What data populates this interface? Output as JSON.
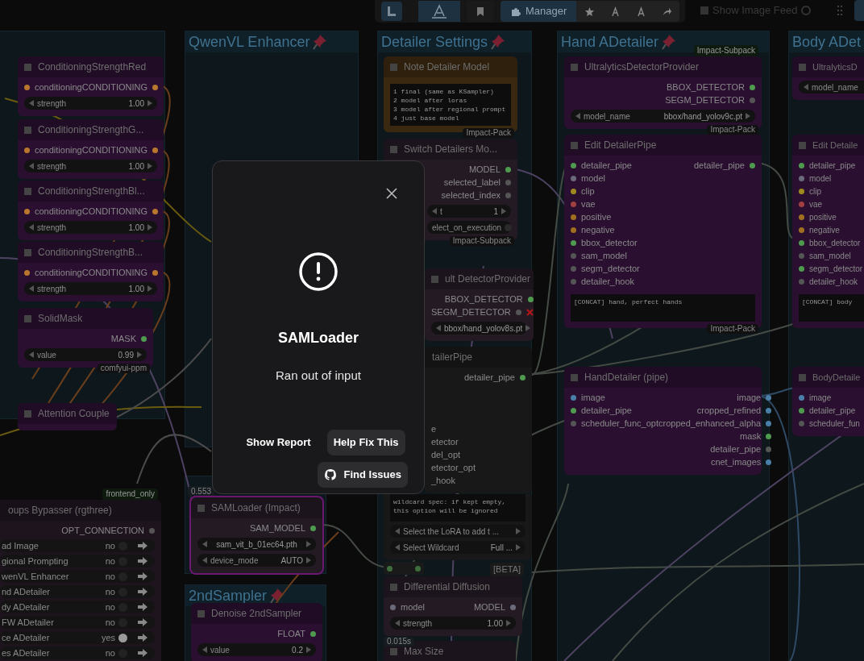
{
  "toolbar": {
    "manager": "Manager",
    "image_feed": "Show Image Feed"
  },
  "groups": [
    {
      "title": "QwenVL Enhancer",
      "pinned": true
    },
    {
      "title": "Detailer Settings",
      "pinned": true
    },
    {
      "title": "Hand ADetailer",
      "pinned": true
    },
    {
      "title": "Body ADet",
      "pinned": false
    },
    {
      "title": "2ndSampler",
      "pinned": true
    }
  ],
  "nodes": [
    {
      "title": "ConditioningStrengthRed",
      "color": "#2a0f30",
      "inputs": [
        {
          "label": "conditioning",
          "color": "#b8772c"
        }
      ],
      "outputs": [
        {
          "label": "CONDITIONING",
          "color": "#b8772c"
        }
      ],
      "widgets": [
        {
          "label": "strength",
          "value": "1.00"
        }
      ]
    },
    {
      "title": "ConditioningStrengthG...",
      "color": "#2a0f30",
      "inputs": [
        {
          "label": "conditioning",
          "color": "#b8772c"
        }
      ],
      "outputs": [
        {
          "label": "CONDITIONING",
          "color": "#b8772c"
        }
      ],
      "widgets": [
        {
          "label": "strength",
          "value": "1.00"
        }
      ]
    },
    {
      "title": "ConditioningStrengthBl...",
      "color": "#2a0f30",
      "inputs": [
        {
          "label": "conditioning",
          "color": "#b8772c"
        }
      ],
      "outputs": [
        {
          "label": "CONDITIONING",
          "color": "#b8772c"
        }
      ],
      "widgets": [
        {
          "label": "strength",
          "value": "1.00"
        }
      ]
    },
    {
      "title": "ConditioningStrengthB...",
      "color": "#2a0f30",
      "inputs": [
        {
          "label": "conditioning",
          "color": "#b8772c"
        }
      ],
      "outputs": [
        {
          "label": "CONDITIONING",
          "color": "#b8772c"
        }
      ],
      "widgets": [
        {
          "label": "strength",
          "value": "1.00"
        }
      ]
    },
    {
      "title": "SolidMask",
      "color": "#2a0f30",
      "outputs": [
        {
          "label": "MASK",
          "color": "#4e9a4e"
        }
      ],
      "widgets": [
        {
          "label": "value",
          "value": "0.99"
        }
      ],
      "badge": "comfyui-ppm"
    },
    {
      "title": "Attention Couple",
      "color": "#2a0f30"
    },
    {
      "title": "Note Detailer Model",
      "color": "#3a2810",
      "text": "1 final (same as KSampler)\n2 model after loras\n3 model after regional prompt\n4 just base model",
      "badge": "Impact-Pack"
    },
    {
      "title": "Switch Detailers Mo...",
      "color": "#241a24",
      "outputs": [
        {
          "label": "MODEL",
          "color": "#4e9a4e"
        },
        {
          "label": "selected_label",
          "color": "#555555"
        },
        {
          "label": "selected_index",
          "color": "#555555"
        }
      ],
      "widgets": [
        {
          "label": "t",
          "value": "1"
        },
        {
          "label": "elect_on_execution",
          "kind": "toggle"
        }
      ],
      "badge": "Impact-Subpack"
    },
    {
      "title": "ult DetectorProvider",
      "color": "#241a24",
      "outputs": [
        {
          "label": "BBOX_DETECTOR",
          "color": "#4e9a4e"
        },
        {
          "label": "SEGM_DETECTOR",
          "color": "#555555",
          "error": true
        }
      ],
      "widgets": [
        {
          "value": "bbox/hand_yolov8s.pt"
        }
      ]
    },
    {
      "title": "tailerPipe",
      "color": "#181818",
      "outputs": [
        {
          "label": "detailer_pipe",
          "color": "#4e9a4e"
        }
      ],
      "inputs": [
        {
          "label": "e"
        },
        {
          "label": "etector"
        },
        {
          "label": "del_opt"
        },
        {
          "label": "etector_opt"
        },
        {
          "label": "_hook"
        }
      ],
      "text": "wildcard spec: if kept empty, this option will be ignored",
      "widgets": [
        {
          "label": "Select the LoRA to add t ..."
        },
        {
          "label": "Select Wildcard",
          "value": "Full ..."
        }
      ]
    },
    {
      "kind": "reroute",
      "badge": "[BETA]"
    },
    {
      "title": "Differential Diffusion",
      "color": "#241a24",
      "inputs": [
        {
          "label": "model",
          "color": "#6a6a7a"
        }
      ],
      "outputs": [
        {
          "label": "MODEL",
          "color": "#6a6a7a"
        }
      ],
      "widgets": [
        {
          "label": "strength",
          "value": "1.00"
        }
      ],
      "timing": "0.015s"
    },
    {
      "title": "Max Size",
      "color": "#241a24"
    },
    {
      "title": "UltralyticsDetectorProvider",
      "color": "#2a0f30",
      "badge_above": "Impact-Subpack",
      "outputs": [
        {
          "label": "BBOX_DETECTOR",
          "color": "#4e9a4e"
        },
        {
          "label": "SEGM_DETECTOR",
          "color": "#555555"
        }
      ],
      "widgets": [
        {
          "label": "model_name",
          "value": "bbox/hand_yolov9c.pt"
        }
      ],
      "badge": "Impact-Pack"
    },
    {
      "title": "Edit DetailerPipe",
      "color": "#2a0f30",
      "inputs": [
        {
          "label": "detailer_pipe",
          "color": "#4e9a4e"
        },
        {
          "label": "model",
          "color": "#6a6a7a"
        },
        {
          "label": "clip",
          "color": "#a08a20"
        },
        {
          "label": "vae",
          "color": "#a04040"
        },
        {
          "label": "positive",
          "color": "#a07020"
        },
        {
          "label": "negative",
          "color": "#a07020"
        },
        {
          "label": "bbox_detector",
          "color": "#4e9a4e"
        },
        {
          "label": "sam_model",
          "color": "#555555"
        },
        {
          "label": "segm_detector",
          "color": "#555555"
        },
        {
          "label": "detailer_hook",
          "color": "#555555"
        }
      ],
      "outputs": [
        {
          "label": "detailer_pipe",
          "color": "#4e9a4e"
        }
      ],
      "text": "[CONCAT] hand, perfect hands",
      "badge": "Impact-Pack"
    },
    {
      "title": "HandDetailer (pipe)",
      "color": "#2a0f30",
      "inputs": [
        {
          "label": "image",
          "color": "#4a7fa8"
        },
        {
          "label": "detailer_pipe",
          "color": "#4e9a4e"
        },
        {
          "label": "scheduler_func_opt",
          "color": "#555555"
        }
      ],
      "outputs": [
        {
          "label": "image",
          "color": "#4a7fa8"
        },
        {
          "label": "cropped_refined",
          "color": "#4a7fa8"
        },
        {
          "label": "cropped_enhanced_alpha",
          "color": "#4a7fa8"
        },
        {
          "label": "mask",
          "color": "#4e9a4e"
        },
        {
          "label": "detailer_pipe",
          "color": "#555555"
        },
        {
          "label": "cnet_images",
          "color": "#4a7fa8"
        }
      ]
    },
    {
      "title": "UltralyticsD",
      "color": "#2a0f30",
      "widgets": [
        {
          "label": "model_name"
        }
      ]
    },
    {
      "title": "Edit Detaile",
      "color": "#2a0f30",
      "inputs": [
        {
          "label": "detailer_pipe",
          "color": "#4e9a4e"
        },
        {
          "label": "model",
          "color": "#6a6a7a"
        },
        {
          "label": "clip",
          "color": "#a08a20"
        },
        {
          "label": "vae",
          "color": "#a04040"
        },
        {
          "label": "positive",
          "color": "#a07020"
        },
        {
          "label": "negative",
          "color": "#a07020"
        },
        {
          "label": "bbox_detector",
          "color": "#4e9a4e"
        },
        {
          "label": "sam_model",
          "color": "#555555"
        },
        {
          "label": "segm_detector",
          "color": "#4e9a4e"
        },
        {
          "label": "detailer_hook",
          "color": "#555555"
        }
      ],
      "text": "[CONCAT] body"
    },
    {
      "title": "BodyDetaile",
      "color": "#2a0f30",
      "inputs": [
        {
          "label": "image",
          "color": "#4a7fa8"
        },
        {
          "label": "detailer_pipe",
          "color": "#4e9a4e"
        },
        {
          "label": "scheduler_fun",
          "color": "#555555"
        }
      ]
    },
    {
      "title": "oups Bypasser (rgthree)",
      "color": "#1e141e",
      "badge_above": "frontend_only",
      "outputs": [
        {
          "label": "OPT_CONNECTION",
          "color": "#555555"
        }
      ],
      "rows": [
        {
          "label": "ad Image",
          "value": "no",
          "on": false
        },
        {
          "label": "gional Prompting",
          "value": "no",
          "on": false
        },
        {
          "label": "wenVL Enhancer",
          "value": "no",
          "on": false
        },
        {
          "label": "nd ADetailer",
          "value": "no",
          "on": false
        },
        {
          "label": "dy ADetailer",
          "value": "no",
          "on": false
        },
        {
          "label": "FW ADetailer",
          "value": "no",
          "on": false
        },
        {
          "label": "ce ADetailer",
          "value": "yes",
          "on": true
        },
        {
          "label": "es ADetailer",
          "value": "no",
          "on": false
        }
      ]
    },
    {
      "title": "SAMLoader (Impact)",
      "color": "#241a24",
      "error": true,
      "timing": "0.553",
      "outputs": [
        {
          "label": "SAM_MODEL",
          "color": "#4e9a4e"
        }
      ],
      "widgets": [
        {
          "value": "sam_vit_b_01ec64.pth"
        },
        {
          "label": "device_mode",
          "value": "AUTO"
        }
      ]
    },
    {
      "title": "Denoise 2ndSampler",
      "color": "#2a0f30",
      "outputs": [
        {
          "label": "FLOAT",
          "color": "#4e9a4e"
        }
      ],
      "widgets": [
        {
          "label": "value",
          "value": "0.2"
        }
      ]
    }
  ],
  "dialog": {
    "title": "SAMLoader",
    "message": "Ran out of input",
    "buttons": [
      {
        "label": "Show Report",
        "kind": "text"
      },
      {
        "label": "Help Fix This",
        "kind": "filled"
      },
      {
        "label": "Find Issues",
        "kind": "github"
      }
    ]
  }
}
